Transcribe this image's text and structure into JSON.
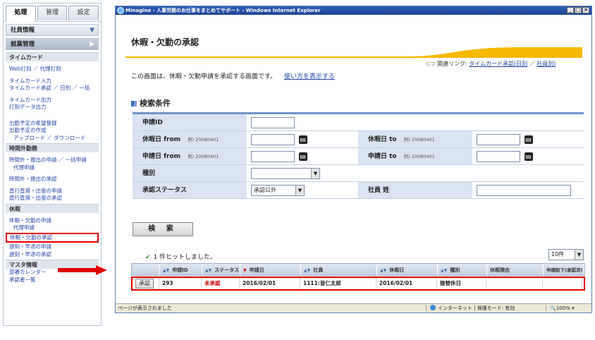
{
  "sidebar": {
    "tabs": [
      "処理",
      "管理",
      "設定"
    ],
    "section_employee": "社員情報",
    "section_work": "就業管理",
    "categories": {
      "timecard": "タイムカード",
      "overtime": "時間外勤務",
      "leave": "休暇",
      "master": "マスタ情報"
    },
    "links": {
      "web_punch": "Web打刻 ／ 代理打刻",
      "timecard_input": "タイムカード入力",
      "timecard_approve": "タイムカード承認 ／ 日別 ／ 一括",
      "timecard_output": "タイムカード出力",
      "punch_data_output": "打刻データ出力",
      "attend_plan_request": "出勤予定の希望登録",
      "attend_plan_create": "出勤予定の作成",
      "upload_download": "アップロード ／ ダウンロード",
      "overtime_request": "時間外・振出の申請 ／ 一括申請",
      "proxy_request": "代理申請",
      "overtime_approve": "時間外・振出の承認",
      "direct_request": "直行直帰・出張の申請",
      "direct_approve": "直行直帰・出張の承認",
      "leave_request": "休暇・欠勤の申請",
      "proxy_request2": "代理申請",
      "leave_approve": "休暇・欠勤の承認",
      "late_request": "遅刻・早退の申請",
      "late_approve": "遅刻・早退の承認",
      "dept_calendar": "部署カレンダー",
      "approver_list": "承認者一覧"
    }
  },
  "window": {
    "title": "Minagine - 人事労務のお仕事をまとめてサポート - Windows Internet Explorer",
    "buttons": [
      "_",
      "□",
      "×"
    ]
  },
  "page": {
    "title": "休暇・欠勤の承認",
    "related_label": "関連リンク:",
    "related_link1": "タイムカード承認(日別",
    "related_sep": "／",
    "related_link2": "社員別)",
    "intro": "この画面は、休暇・欠勤申請を承認する画面です。",
    "howto": "使い方を表示する",
    "search_title": "検索条件"
  },
  "form": {
    "request_id": "申請ID",
    "leave_from": "休暇日 from",
    "leave_to": "休暇日 to",
    "req_from": "申請日 from",
    "req_to": "申請日 to",
    "example": "例) 20080401",
    "kind": "種別",
    "status_label": "承認ステータス",
    "status_value": "承認以外",
    "employee_name": "社員 姓",
    "search_button": "検 索"
  },
  "results": {
    "hit_text": "1 件ヒットしました。",
    "per_page": "10件",
    "headers": [
      "申請ID",
      "ステータス",
      "申請日",
      "社員",
      "休暇日",
      "種別",
      "休暇理由",
      "申請取下(承認済)"
    ],
    "row": {
      "action": "承認",
      "id": "293",
      "status": "未承認",
      "request_date": "2016/02/01",
      "employee": "1111:皆仁太郎",
      "leave_date": "2016/02/01",
      "kind": "振替休日",
      "reason": "",
      "withdraw": ""
    }
  },
  "statusbar": {
    "left": "ページが表示されました",
    "zone": "インターネット | 保護モード: 有効",
    "zoom": "100%"
  },
  "colors": {
    "highlight": "#e00000",
    "link": "#2446a8",
    "form_label_bg": "#d9e3f1",
    "title_swoosh": "#f6b800"
  }
}
